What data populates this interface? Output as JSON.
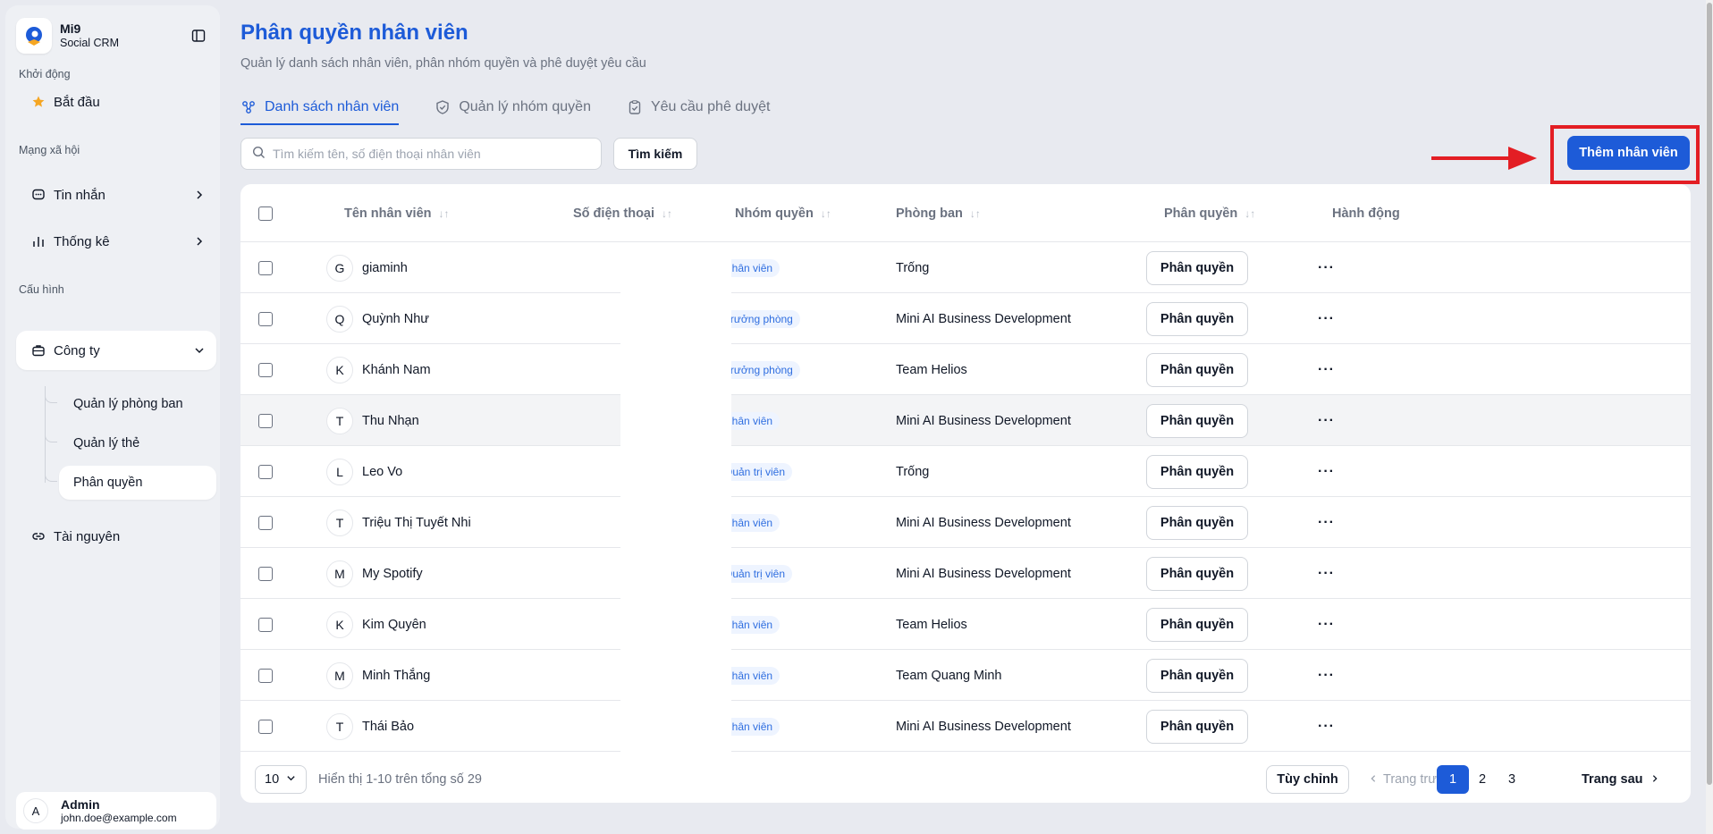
{
  "brand": {
    "name": "Mi9",
    "sub": "Social CRM"
  },
  "sidebar": {
    "sections": {
      "start": "Khởi động",
      "social": "Mạng xã hội",
      "config": "Cấu hình"
    },
    "items": {
      "begin": "Bắt đầu",
      "messages": "Tin nhắn",
      "stats": "Thống kê",
      "company": "Công ty",
      "resources": "Tài nguyên"
    },
    "company_sub": [
      "Quản lý phòng ban",
      "Quản lý thẻ",
      "Phân quyền"
    ],
    "user": {
      "initial": "A",
      "name": "Admin",
      "email": "john.doe@example.com"
    }
  },
  "page": {
    "title": "Phân quyền nhân viên",
    "subtitle": "Quản lý danh sách nhân viên, phân nhóm quyền và phê duyệt yêu cầu",
    "tabs": [
      "Danh sách nhân viên",
      "Quản lý nhóm quyền",
      "Yêu cầu phê duyệt"
    ]
  },
  "toolbar": {
    "search_placeholder": "Tìm kiếm tên, số điện thoại nhân viên",
    "search_button": "Tìm kiếm",
    "add_button": "Thêm nhân viên"
  },
  "table": {
    "headers": {
      "name": "Tên nhân viên",
      "phone": "Số điện thoại",
      "group": "Nhóm quyền",
      "dept": "Phòng ban",
      "perm": "Phân quyền",
      "action": "Hành động"
    },
    "rows": [
      {
        "initial": "G",
        "name": "giaminh",
        "group": "Nhân viên",
        "dept": "Trống",
        "perm": "Phân quyền",
        "action": "···"
      },
      {
        "initial": "Q",
        "name": "Quỳnh Như",
        "group": "Trưởng phòng",
        "dept": "Mini AI Business Development",
        "perm": "Phân quyền",
        "action": "···"
      },
      {
        "initial": "K",
        "name": "Khánh Nam",
        "group": "Trưởng phòng",
        "dept": "Team Helios",
        "perm": "Phân quyền",
        "action": "···"
      },
      {
        "initial": "T",
        "name": "Thu Nhạn",
        "group": "Nhân viên",
        "dept": "Mini AI Business Development",
        "perm": "Phân quyền",
        "action": "···"
      },
      {
        "initial": "L",
        "name": "Leo Vo",
        "group": "Quản trị viên",
        "dept": "Trống",
        "perm": "Phân quyền",
        "action": "···"
      },
      {
        "initial": "T",
        "name": "Triệu Thị Tuyết Nhi",
        "group": "Nhân viên",
        "dept": "Mini AI Business Development",
        "perm": "Phân quyền",
        "action": "···"
      },
      {
        "initial": "M",
        "name": "My Spotify",
        "group": "Quản trị viên",
        "dept": "Mini AI Business Development",
        "perm": "Phân quyền",
        "action": "···"
      },
      {
        "initial": "K",
        "name": "Kim Quyên",
        "group": "Nhân viên",
        "dept": "Team Helios",
        "perm": "Phân quyền",
        "action": "···"
      },
      {
        "initial": "M",
        "name": "Minh Thắng",
        "group": "Nhân viên",
        "dept": "Team Quang Minh",
        "perm": "Phân quyền",
        "action": "···"
      },
      {
        "initial": "T",
        "name": "Thái Bảo",
        "group": "Nhân viên",
        "dept": "Mini AI Business Development",
        "perm": "Phân quyền",
        "action": "···"
      }
    ]
  },
  "footer": {
    "page_size": "10",
    "info": "Hiển thị 1-10 trên tổng số 29",
    "customize": "Tùy chỉnh",
    "prev": "Trang trước",
    "pages": [
      "1",
      "2",
      "3"
    ],
    "next": "Trang sau"
  },
  "colors": {
    "accent": "#1d5bd8",
    "highlight": "#e31e24"
  }
}
